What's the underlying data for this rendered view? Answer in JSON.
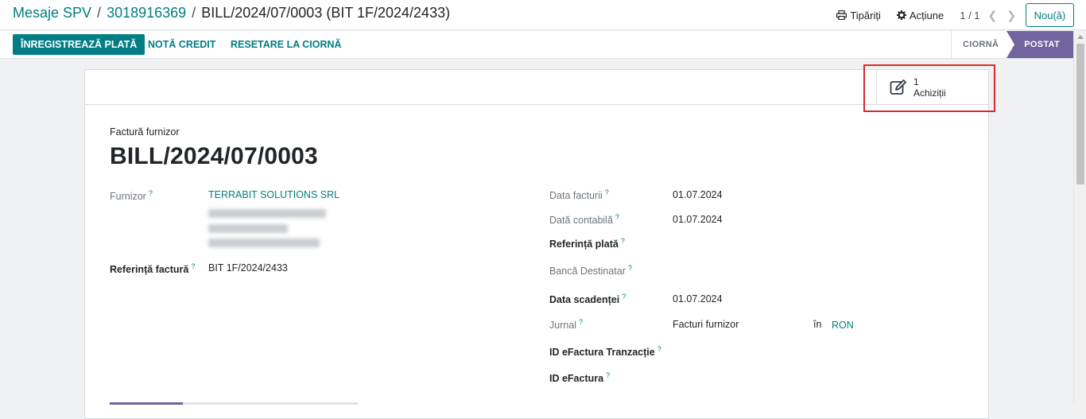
{
  "breadcrumb": {
    "item1": "Mesaje SPV",
    "item2": "3018916369",
    "current": "BILL/2024/07/0003 (BIT 1F/2024/2433)",
    "separator": "/"
  },
  "top_actions": {
    "print_label": "Tipăriți",
    "action_label": "Acțiune",
    "pager": "1 / 1",
    "new_label": "Nou(ă)"
  },
  "control_bar": {
    "register_payment": "ÎNREGISTREAZĂ PLATĂ",
    "credit_note": "NOTĂ CREDIT",
    "reset_draft": "RESETARE LA CIORNĂ"
  },
  "status_bar": {
    "draft": "CIORNĂ",
    "posted": "POSTAT"
  },
  "smart_button": {
    "count": "1",
    "label": "Achiziții"
  },
  "form": {
    "type_label": "Factură furnizor",
    "title": "BILL/2024/07/0003",
    "help_mark": "?",
    "left": {
      "vendor_label": "Furnizor",
      "vendor_value": "TERRABIT SOLUTIONS SRL",
      "ref_label": "Referință factură",
      "ref_value": "BIT 1F/2024/2433"
    },
    "right": {
      "invoice_date_label": "Data facturii",
      "invoice_date_value": "01.07.2024",
      "accounting_date_label": "Dată contabilă",
      "accounting_date_value": "01.07.2024",
      "payment_ref_label": "Referință plată",
      "bank_label": "Bancă Destinatar",
      "due_date_label": "Data scadenței",
      "due_date_value": "01.07.2024",
      "journal_label": "Jurnal",
      "journal_value": "Facturi furnizor",
      "in_label": "în",
      "currency_value": "RON",
      "efactura_tx_label": "ID eFactura Tranzacție",
      "efactura_label": "ID eFactura"
    }
  },
  "colors": {
    "accent": "#017e84",
    "status_active": "#71639e",
    "highlight": "#d92a2a"
  }
}
